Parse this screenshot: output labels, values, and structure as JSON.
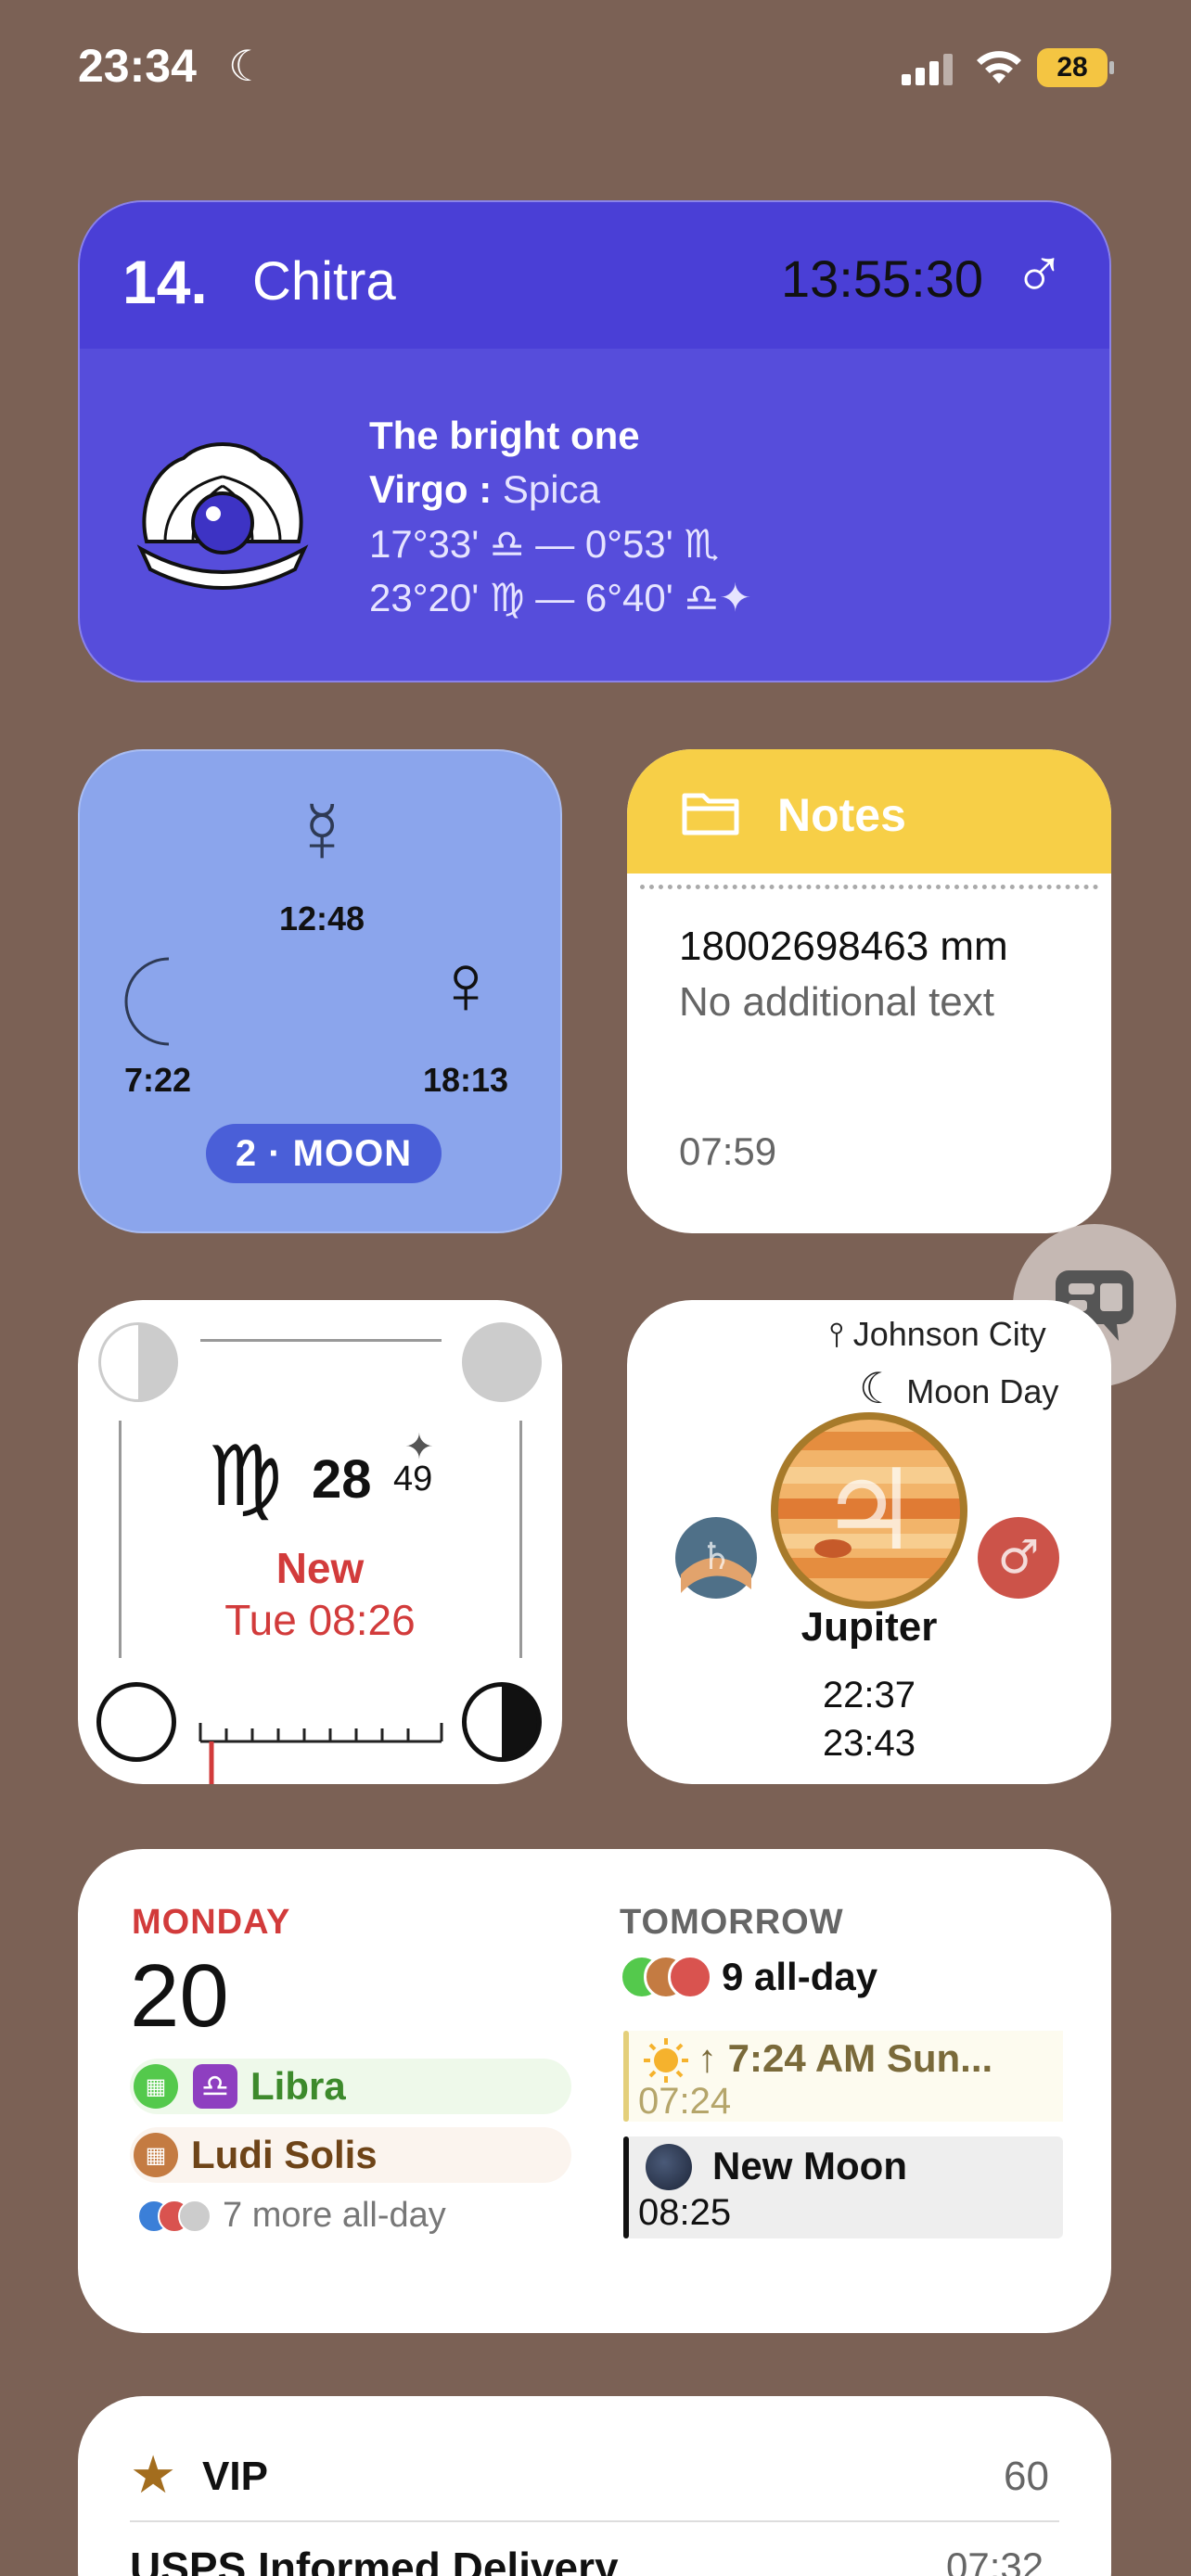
{
  "status_bar": {
    "time": "23:34",
    "focus_icon": "moon-icon",
    "battery": "28",
    "accent_battery": "#f4c542"
  },
  "nakshatra": {
    "number": "14.",
    "name": "Chitra",
    "clock": "13:55:30",
    "ruler_symbol": "♂",
    "meaning": "The bright one",
    "sign_label": "Virgo :",
    "star": "Spica",
    "range1": "17°33' ♎ — 0°53' ♏",
    "range2": "23°20' ♍ — 6°40' ♎✦",
    "bg_color": "#564ddb"
  },
  "planet_hours": {
    "top_symbol": "☿",
    "top_time": "12:48",
    "left_time": "7:22",
    "right_symbol": "♀",
    "right_time": "18:13",
    "badge": "2 · MOON"
  },
  "notes": {
    "title": "Notes",
    "line1": "18002698463 mm",
    "line2": "No additional text",
    "time": "07:59"
  },
  "moon_phase": {
    "sign": "♍",
    "degree": "28",
    "minute": "49",
    "star": "✦",
    "phase": "New",
    "when": "Tue  08:26"
  },
  "jupiter": {
    "location": "Johnson City",
    "location_icon": "pin-icon",
    "day_label": "Moon Day",
    "planet": "Jupiter",
    "time1": "22:37",
    "time2": "23:43",
    "left_symbol": "♄",
    "right_symbol": "♂"
  },
  "calendar": {
    "today_label": "MONDAY",
    "today_date": "20",
    "today_events": [
      {
        "title": "Libra",
        "symbol": "♎"
      },
      {
        "title": "Ludi Solis"
      }
    ],
    "today_more": "7 more all-day",
    "tomorrow_label": "TOMORROW",
    "tomorrow_allday": "9 all-day",
    "tomorrow_events": [
      {
        "title": "↑ 7:24 AM Sun...",
        "time": "07:24"
      },
      {
        "title": "New Moon",
        "time": "08:25"
      }
    ]
  },
  "vip": {
    "title": "VIP",
    "count": "60",
    "first_sender": "USPS Informed Delivery",
    "first_time": "07:32"
  }
}
